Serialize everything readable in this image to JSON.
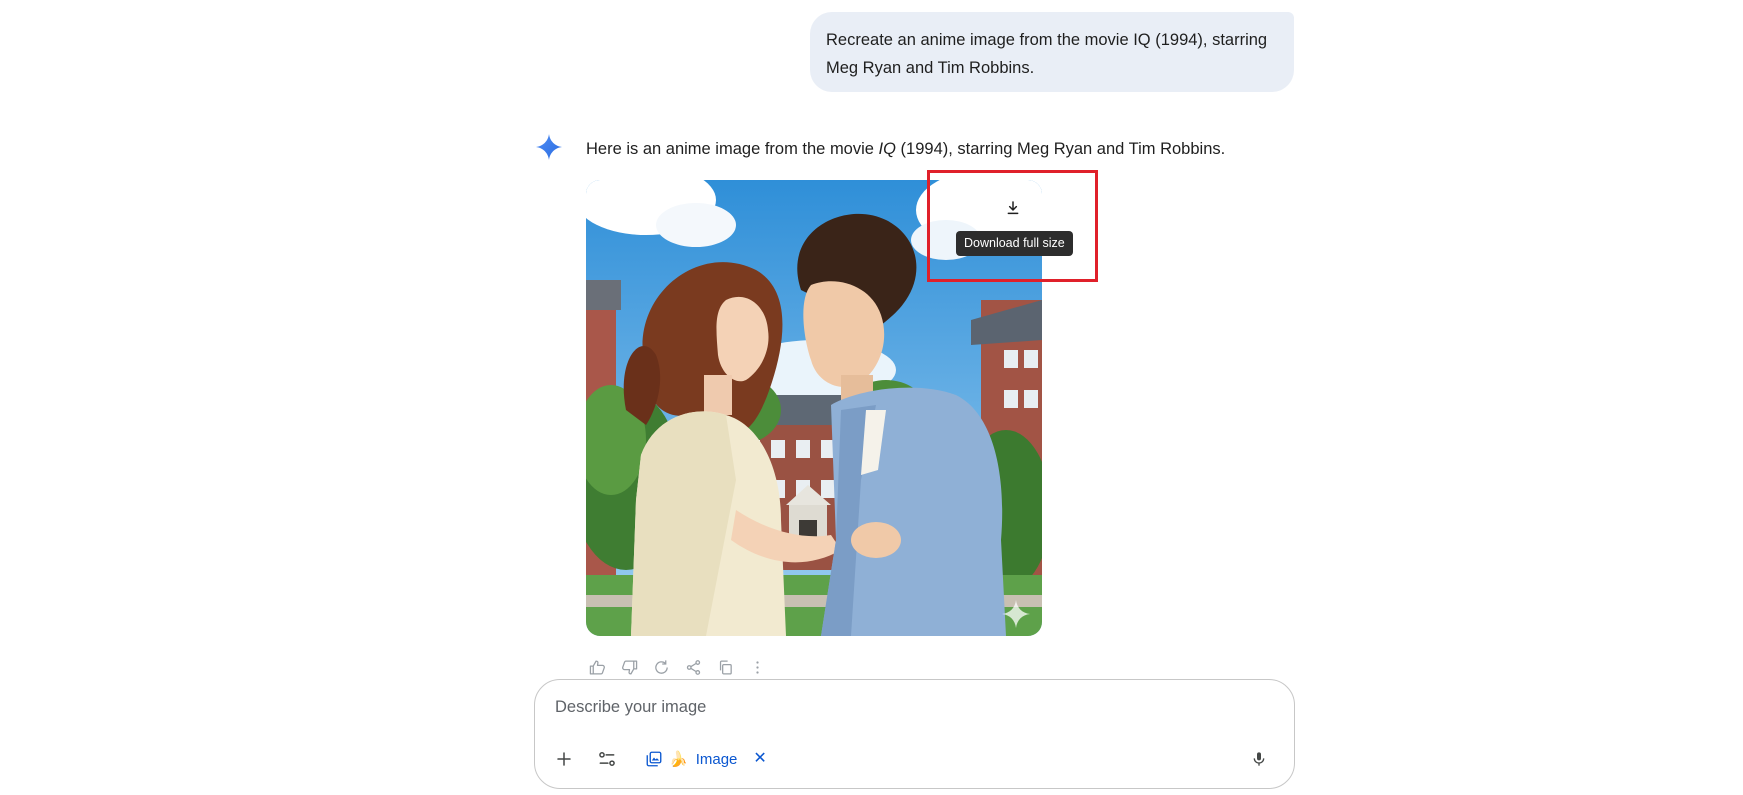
{
  "user_message": {
    "line1": "Recreate an anime image from the movie IQ (1994), starring",
    "line2": "Meg Ryan and Tim Robbins."
  },
  "response": {
    "text_before": "Here is an anime image from the movie ",
    "text_italic": "IQ",
    "text_after": " (1994), starring Meg Ryan and Tim Robbins."
  },
  "image": {
    "download_tooltip": "Download full size"
  },
  "actions": [
    "thumb-up-icon",
    "thumb-down-icon",
    "regenerate-icon",
    "share-icon",
    "copy-icon",
    "more-vert-icon"
  ],
  "composer": {
    "placeholder": "Describe your image",
    "tool_chip_label": "Image",
    "tool_chip_emoji": "🍌",
    "tool_chip_close": "✕"
  },
  "colors": {
    "accent": "#0b57d0",
    "highlight": "#e0202a",
    "bubble": "#e9eef6"
  }
}
